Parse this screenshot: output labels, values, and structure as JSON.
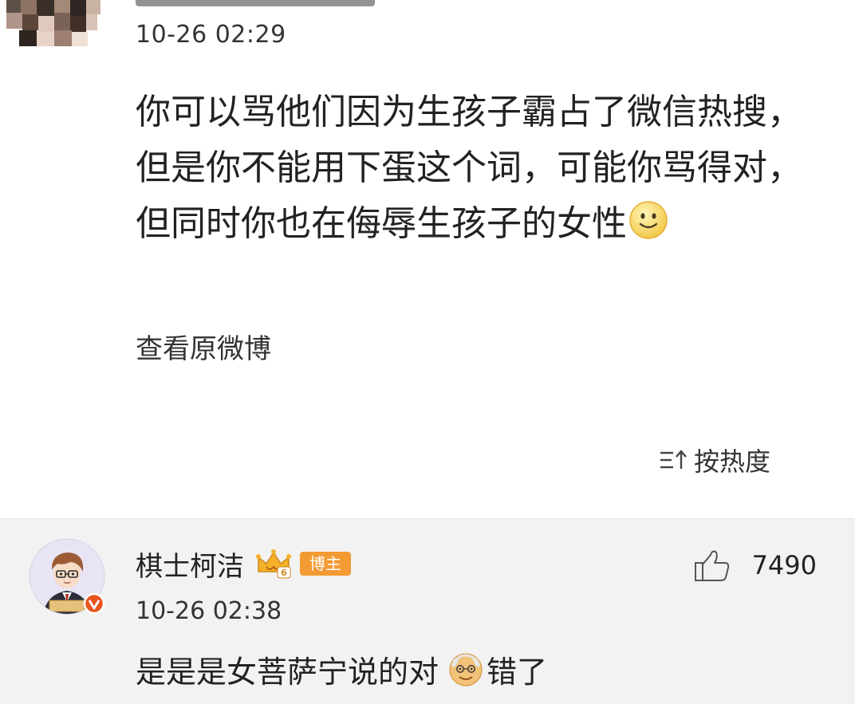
{
  "post": {
    "timestamp": "10-26 02:29",
    "text": "你可以骂他们因为生孩子霸占了微信热搜，但是你不能用下蛋这个词，可能你骂得对，但同时你也在侮辱生孩子的女性",
    "text_emoji": "smile-icon",
    "view_original_label": "查看原微博"
  },
  "sort": {
    "label": "按热度",
    "icon": "sort-icon"
  },
  "comment": {
    "author": "棋士柯洁",
    "badge": "博主",
    "vip_icon": "vip-crown-icon",
    "timestamp": "10-26 02:38",
    "like_count": "7490",
    "text_before": "是是是女菩萨宁说的对",
    "text_emoji": "grandpa-icon",
    "text_after": "错了"
  },
  "colors": {
    "badge": "#f39a33",
    "verified": "#e8541e",
    "comment_bg": "#f2f2f2"
  }
}
